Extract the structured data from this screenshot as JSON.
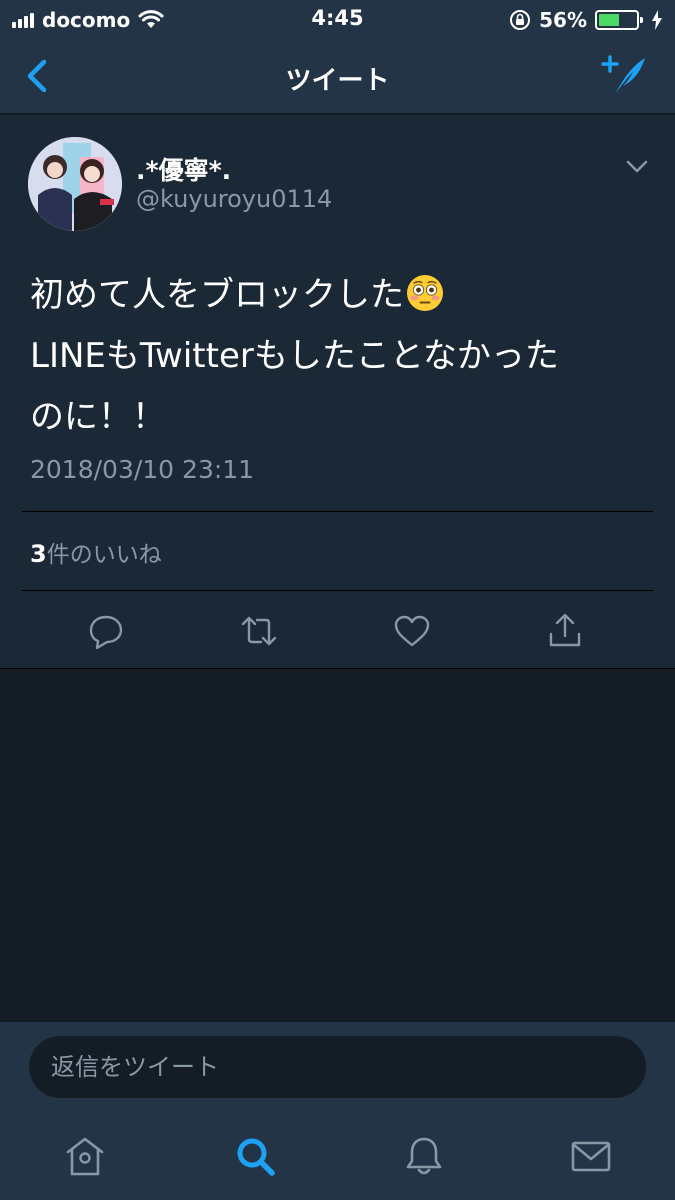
{
  "status_bar": {
    "carrier": "docomo",
    "time": "4:45",
    "battery_percent": "56%",
    "battery_level": 0.56
  },
  "nav": {
    "title": "ツイート",
    "back_icon": "chevron-left-icon",
    "compose_icon": "compose-tweet-icon"
  },
  "tweet": {
    "display_name": ".*優寧*.",
    "username": "@kuyuroyu0114",
    "text_lines": [
      "初めて人をブロックした",
      "LINEもTwitterもしたことなかった",
      "のに！！"
    ],
    "emoji": "flushed-face-emoji",
    "timestamp": "2018/03/10 23:11",
    "likes_count": "3",
    "likes_label": "件のいいね"
  },
  "actions": [
    "reply-icon",
    "retweet-icon",
    "like-icon",
    "share-icon"
  ],
  "reply": {
    "placeholder": "返信をツイート"
  },
  "tabs": [
    "home-icon",
    "search-icon",
    "notifications-icon",
    "messages-icon"
  ],
  "colors": {
    "accent": "#1da1f2",
    "bar_background": "#243447",
    "card_background": "#1b2836",
    "page_background": "#141d26",
    "secondary_text": "#8899a6"
  }
}
